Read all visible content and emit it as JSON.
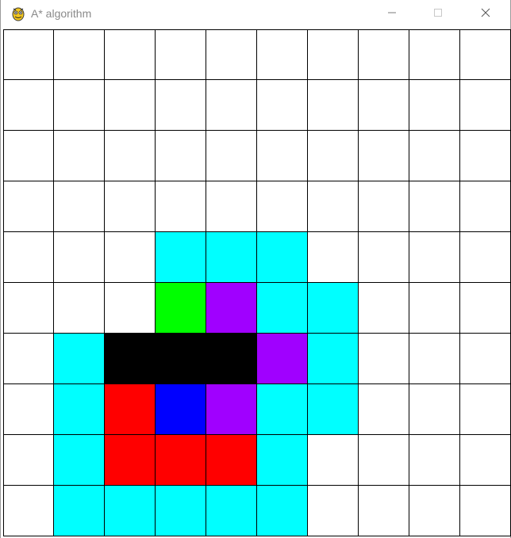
{
  "window": {
    "title": "A* algorithm",
    "icon": "pygame-snake-icon",
    "controls": [
      "minimize-icon",
      "maximize-icon",
      "close-icon"
    ]
  },
  "legend_colors": {
    "empty": "#ffffff",
    "open": "#00ffff",
    "barrier": "#000000",
    "closed": "#a000ff",
    "path": "#ff0000",
    "start": "#00ff00",
    "end": "#0000ff",
    "grid_line": "#000000"
  },
  "grid": {
    "rows": 10,
    "cols": 10,
    "cells": [
      [
        "empty",
        "empty",
        "empty",
        "empty",
        "empty",
        "empty",
        "empty",
        "empty",
        "empty",
        "empty"
      ],
      [
        "empty",
        "empty",
        "empty",
        "empty",
        "empty",
        "empty",
        "empty",
        "empty",
        "empty",
        "empty"
      ],
      [
        "empty",
        "empty",
        "empty",
        "empty",
        "empty",
        "empty",
        "empty",
        "empty",
        "empty",
        "empty"
      ],
      [
        "empty",
        "empty",
        "empty",
        "empty",
        "empty",
        "empty",
        "empty",
        "empty",
        "empty",
        "empty"
      ],
      [
        "empty",
        "empty",
        "empty",
        "open",
        "open",
        "open",
        "empty",
        "empty",
        "empty",
        "empty"
      ],
      [
        "empty",
        "empty",
        "empty",
        "start",
        "closed",
        "open",
        "open",
        "empty",
        "empty",
        "empty"
      ],
      [
        "empty",
        "open",
        "barrier",
        "barrier",
        "barrier",
        "closed",
        "open",
        "empty",
        "empty",
        "empty"
      ],
      [
        "empty",
        "open",
        "path",
        "end",
        "closed",
        "open",
        "open",
        "empty",
        "empty",
        "empty"
      ],
      [
        "empty",
        "open",
        "path",
        "path",
        "path",
        "open",
        "empty",
        "empty",
        "empty",
        "empty"
      ],
      [
        "empty",
        "open",
        "open",
        "open",
        "open",
        "open",
        "empty",
        "empty",
        "empty",
        "empty"
      ]
    ]
  }
}
